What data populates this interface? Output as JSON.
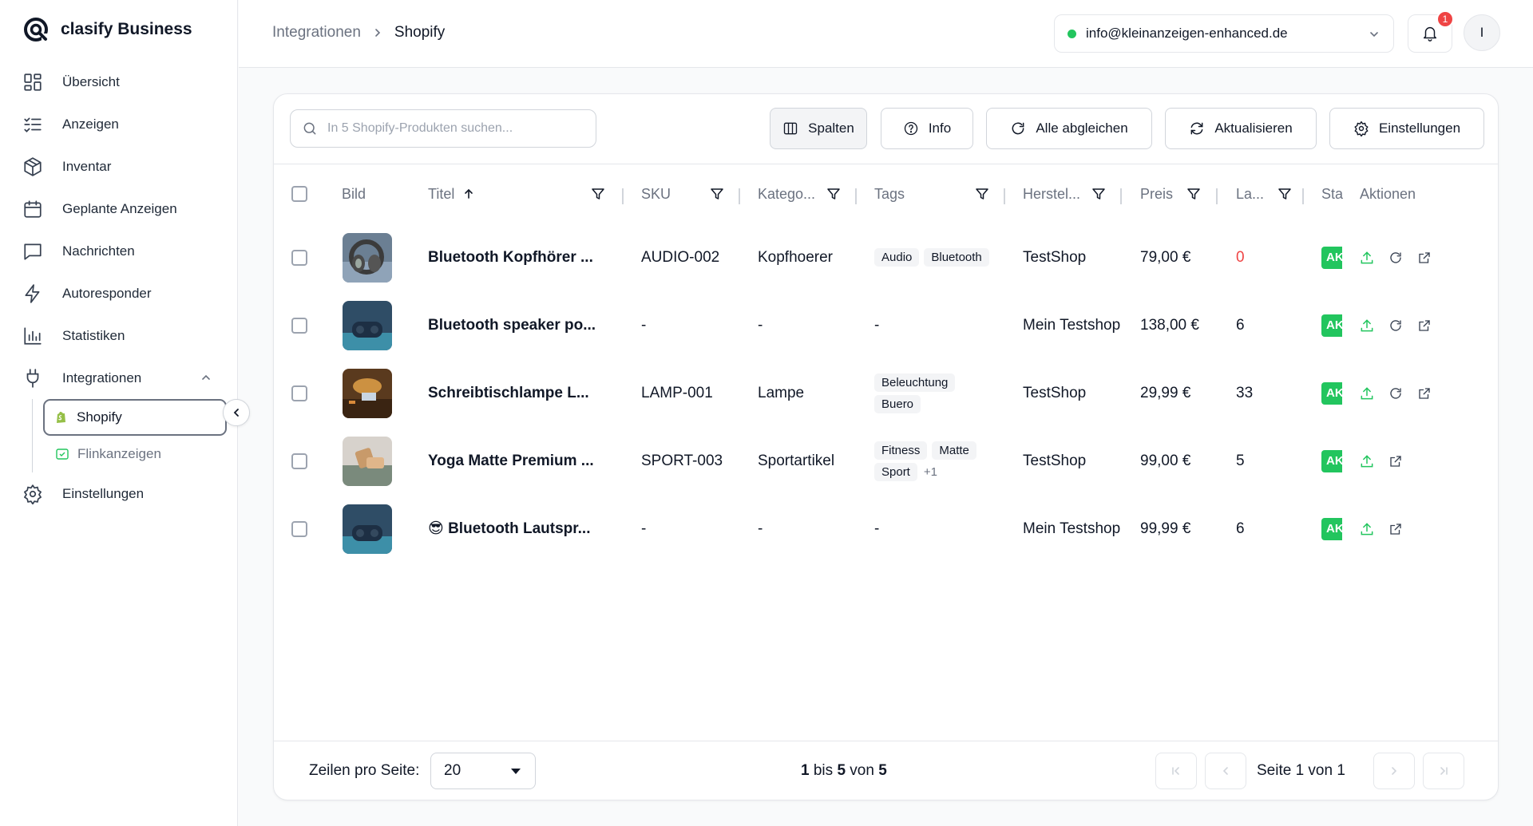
{
  "brand": {
    "name": "clasify Business"
  },
  "sidebar": {
    "items": [
      {
        "label": "Übersicht",
        "icon": "grid-icon"
      },
      {
        "label": "Anzeigen",
        "icon": "list-check-icon"
      },
      {
        "label": "Inventar",
        "icon": "package-icon"
      },
      {
        "label": "Geplante Anzeigen",
        "icon": "calendar-icon"
      },
      {
        "label": "Nachrichten",
        "icon": "message-icon"
      },
      {
        "label": "Autoresponder",
        "icon": "bolt-icon"
      },
      {
        "label": "Statistiken",
        "icon": "bar-chart-icon"
      },
      {
        "label": "Integrationen",
        "icon": "plug-icon"
      },
      {
        "label": "Einstellungen",
        "icon": "gear-icon"
      }
    ],
    "sub_items": [
      {
        "label": "Shopify",
        "icon": "shopify-icon",
        "active": true
      },
      {
        "label": "Flinkanzeigen",
        "icon": "flink-icon",
        "active": false
      }
    ]
  },
  "header": {
    "breadcrumb": [
      "Integrationen",
      "Shopify"
    ],
    "account_email": "info@kleinanzeigen-enhanced.de",
    "notification_count": "1",
    "avatar_initial": "I"
  },
  "toolbar": {
    "search_placeholder": "In 5 Shopify-Produkten suchen...",
    "buttons": {
      "columns": "Spalten",
      "info": "Info",
      "sync_all": "Alle abgleichen",
      "refresh": "Aktualisieren",
      "settings": "Einstellungen"
    }
  },
  "table": {
    "headers": {
      "image": "Bild",
      "title": "Titel",
      "sku": "SKU",
      "category": "Katego...",
      "tags": "Tags",
      "vendor": "Herstel...",
      "price": "Preis",
      "stock": "La...",
      "status": "Sta",
      "actions": "Aktionen"
    },
    "rows": [
      {
        "title": "Bluetooth Kopfhörer ...",
        "sku": "AUDIO-002",
        "category": "Kopfhoerer",
        "tags": [
          "Audio",
          "Bluetooth"
        ],
        "tags_more": "",
        "vendor": "TestShop",
        "price": "79,00 €",
        "stock": "0",
        "status": "AKTIV",
        "thumb": "headphones"
      },
      {
        "title": "Bluetooth speaker po...",
        "sku": "-",
        "category": "-",
        "tags_text": "-",
        "vendor": "Mein Testshop",
        "price": "138,00 €",
        "stock": "6",
        "status": "AKTIV",
        "thumb": "speaker"
      },
      {
        "title": "Schreibtischlampe L...",
        "sku": "LAMP-001",
        "category": "Lampe",
        "tags": [
          "Beleuchtung",
          "Buero"
        ],
        "tags_more": "",
        "vendor": "TestShop",
        "price": "29,99 €",
        "stock": "33",
        "status": "AKTIV",
        "thumb": "lamp"
      },
      {
        "title": "Yoga Matte Premium ...",
        "sku": "SPORT-003",
        "category": "Sportartikel",
        "tags": [
          "Fitness",
          "Matte",
          "Sport"
        ],
        "tags_more": "+1",
        "vendor": "TestShop",
        "price": "99,00 €",
        "stock": "5",
        "status": "AKTIV",
        "thumb": "yoga"
      },
      {
        "title": "😎 Bluetooth Lautspr...",
        "sku": "-",
        "category": "-",
        "tags_text": "-",
        "vendor": "Mein Testshop",
        "price": "99,99 €",
        "stock": "6",
        "status": "AKTIV",
        "thumb": "speaker"
      }
    ]
  },
  "footer": {
    "rows_per_page_label": "Zeilen pro Seite:",
    "rows_per_page_value": "20",
    "range_from": "1",
    "range_mid": "bis",
    "range_to": "5",
    "range_of": "von",
    "range_total": "5",
    "page_info": "Seite 1 von 1"
  },
  "colors": {
    "accent_green": "#22c55e",
    "danger_red": "#ef4444"
  }
}
